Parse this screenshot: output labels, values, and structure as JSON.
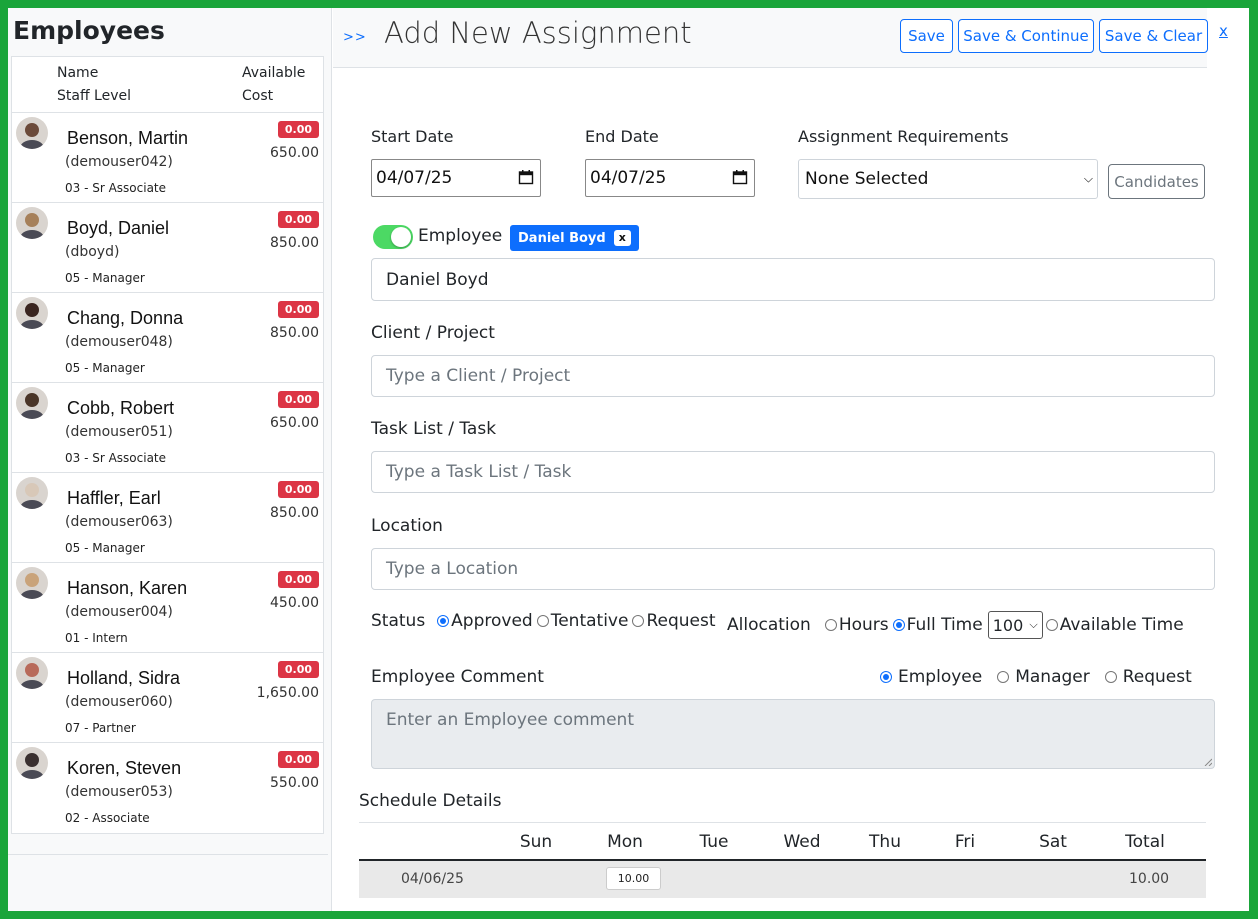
{
  "sidebar": {
    "title": "Employees",
    "header": {
      "name": "Name",
      "available": "Available",
      "staff_level": "Staff Level",
      "cost": "Cost"
    },
    "employees": [
      {
        "name": "Benson, Martin",
        "user": "(demouser042)",
        "level": "03 - Sr Associate",
        "available": "0.00",
        "cost": "650.00",
        "avatar_color": "#6b4a3a"
      },
      {
        "name": "Boyd, Daniel",
        "user": "(dboyd)",
        "level": "05 - Manager",
        "available": "0.00",
        "cost": "850.00",
        "avatar_color": "#a6805a"
      },
      {
        "name": "Chang, Donna",
        "user": "(demouser048)",
        "level": "05 - Manager",
        "available": "0.00",
        "cost": "850.00",
        "avatar_color": "#3a2520"
      },
      {
        "name": "Cobb, Robert",
        "user": "(demouser051)",
        "level": "03 - Sr Associate",
        "available": "0.00",
        "cost": "650.00",
        "avatar_color": "#4a3528"
      },
      {
        "name": "Haffler, Earl",
        "user": "(demouser063)",
        "level": "05 - Manager",
        "available": "0.00",
        "cost": "850.00",
        "avatar_color": "#d8c8b8"
      },
      {
        "name": "Hanson, Karen",
        "user": "(demouser004)",
        "level": "01 - Intern",
        "available": "0.00",
        "cost": "450.00",
        "avatar_color": "#c9a37a"
      },
      {
        "name": "Holland, Sidra",
        "user": "(demouser060)",
        "level": "07 - Partner",
        "available": "0.00",
        "cost": "1,650.00",
        "avatar_color": "#b86a5a"
      },
      {
        "name": "Koren, Steven",
        "user": "(demouser053)",
        "level": "02 - Associate",
        "available": "0.00",
        "cost": "550.00",
        "avatar_color": "#3a3030"
      }
    ]
  },
  "header": {
    "expand": ">>",
    "title": "Add New Assignment",
    "save": "Save",
    "save_continue": "Save & Continue",
    "save_clear": "Save & Clear",
    "close": "x"
  },
  "form": {
    "start_date_label": "Start Date",
    "start_date": "04/07/25",
    "end_date_label": "End Date",
    "end_date": "04/07/25",
    "requirements_label": "Assignment Requirements",
    "requirements_value": "None Selected",
    "candidates": "Candidates",
    "employee_label": "Employee",
    "employee_chip": "Daniel Boyd",
    "employee_chip_remove": "x",
    "employee_value": "Daniel Boyd",
    "client_label": "Client / Project",
    "client_placeholder": "Type a Client / Project",
    "task_label": "Task List / Task",
    "task_placeholder": "Type a Task List / Task",
    "location_label": "Location",
    "location_placeholder": "Type a Location",
    "status_label": "Status",
    "status_options": [
      "Approved",
      "Tentative",
      "Request"
    ],
    "allocation_label": "Allocation",
    "allocation_options": [
      "Hours",
      "Full Time",
      "Available Time"
    ],
    "allocation_percent": "100",
    "comment_label": "Employee Comment",
    "comment_options": [
      "Employee",
      "Manager",
      "Request"
    ],
    "comment_placeholder": "Enter an Employee comment"
  },
  "schedule": {
    "title": "Schedule Details",
    "days": [
      "Sun",
      "Mon",
      "Tue",
      "Wed",
      "Thu",
      "Fri",
      "Sat",
      "Total"
    ],
    "rows": [
      {
        "week": "04/06/25",
        "mon": "10.00",
        "total": "10.00"
      }
    ]
  },
  "colors": {
    "primary": "#0d6efd",
    "danger": "#dc3545",
    "toggle_on": "#4cd964",
    "frame": "#1aa53a"
  }
}
